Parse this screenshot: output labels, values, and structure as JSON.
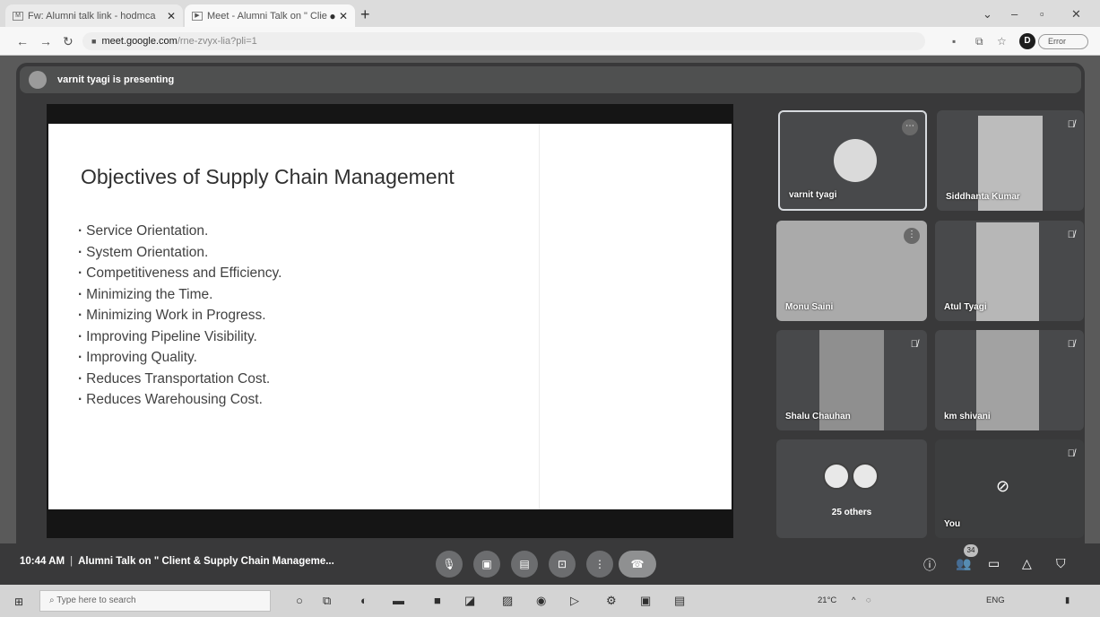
{
  "browser": {
    "tabs": [
      {
        "label": "Fw: Alumni talk link - hodmca",
        "active": false
      },
      {
        "label": "Meet - Alumni Talk on \" Clie",
        "active": true
      }
    ],
    "url_host": "meet.google.com",
    "url_path": "/rne-zvyx-lia?pli=1",
    "error_label": "Error"
  },
  "meet": {
    "presenting_text": "varnit tyagi is presenting",
    "slide": {
      "title": "Objectives of Supply Chain Management",
      "bullets": [
        "Service Orientation.",
        "System Orientation.",
        "Competitiveness and Efficiency.",
        "Minimizing the Time.",
        "Minimizing Work in Progress.",
        "Improving Pipeline Visibility.",
        "Improving Quality.",
        "Reduces Transportation Cost.",
        "Reduces Warehousing Cost."
      ]
    },
    "participants": [
      {
        "name": "varnit tyagi"
      },
      {
        "name": "Siddhanta Kumar"
      },
      {
        "name": "Monu Saini"
      },
      {
        "name": "Atul Tyagi"
      },
      {
        "name": "Shalu Chauhan"
      },
      {
        "name": "km shivani"
      }
    ],
    "others_label": "25 others",
    "you_label": "You",
    "time": "10:44 AM",
    "meeting_title": "Alumni Talk on \" Client & Supply Chain Manageme...",
    "participant_count": "34"
  },
  "taskbar": {
    "search_placeholder": "Type here to search",
    "temperature": "21°C",
    "language": "ENG"
  }
}
